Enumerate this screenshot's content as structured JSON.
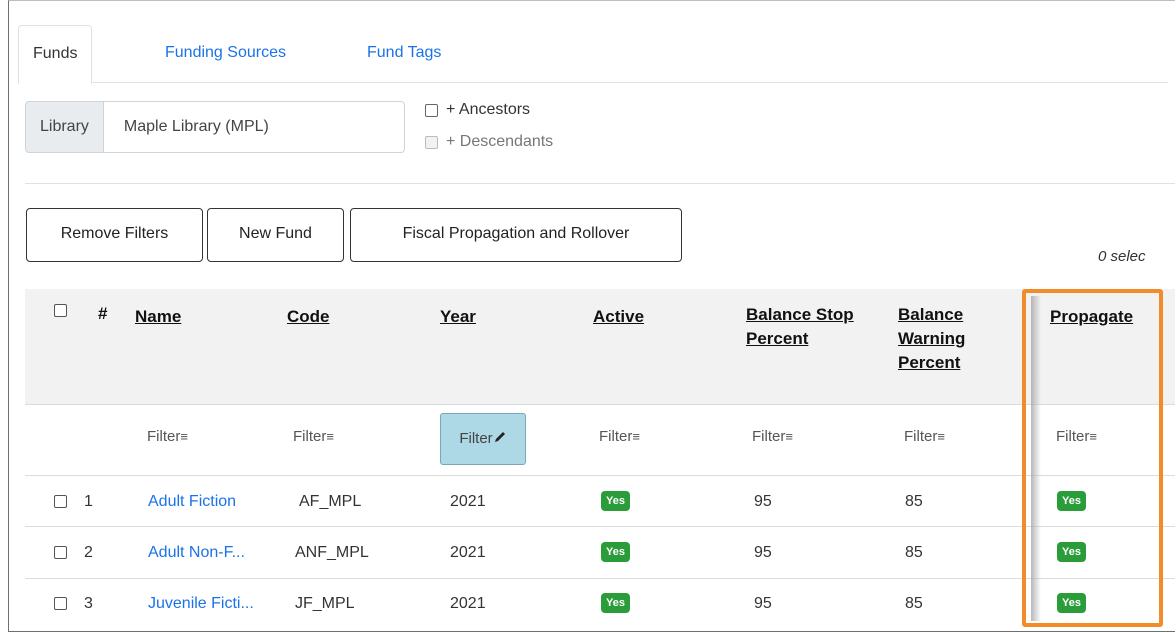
{
  "tabs": [
    "Funds",
    "Funding Sources",
    "Fund Tags"
  ],
  "library": {
    "label": "Library",
    "value": "Maple Library (MPL)",
    "ancestors_label": "+ Ancestors",
    "descendants_label": "+ Descendants"
  },
  "buttons": {
    "remove_filters": "Remove Filters",
    "new_fund": "New Fund",
    "fiscal": "Fiscal Propagation and Rollover"
  },
  "selected_text": "0 selec",
  "table": {
    "headers": {
      "hash": "#",
      "name": "Name",
      "code": "Code",
      "year": "Year",
      "active": "Active",
      "stop_1": "Balance Stop",
      "stop_2": "Percent",
      "warn_1": "Balance",
      "warn_2": "Warning",
      "warn_3": "Percent",
      "propagate": "Propagate"
    },
    "filter_label": "Filter",
    "filter_icon": "≡",
    "filter_edit_icon": "pencil-icon",
    "rows": [
      {
        "num": "1",
        "name": "Adult Fiction",
        "code": "AF_MPL",
        "year": "2021",
        "active": "Yes",
        "stop": "95",
        "warn": "85",
        "propagate": "Yes"
      },
      {
        "num": "2",
        "name": "Adult Non-F...",
        "code": "ANF_MPL",
        "year": "2021",
        "active": "Yes",
        "stop": "95",
        "warn": "85",
        "propagate": "Yes"
      },
      {
        "num": "3",
        "name": "Juvenile Ficti...",
        "code": "JF_MPL",
        "year": "2021",
        "active": "Yes",
        "stop": "95",
        "warn": "85",
        "propagate": "Yes"
      }
    ]
  },
  "colors": {
    "link": "#1a73e8",
    "badge": "#2a9d3a",
    "highlight": "#f28c28",
    "active_filter": "#add8e6"
  }
}
